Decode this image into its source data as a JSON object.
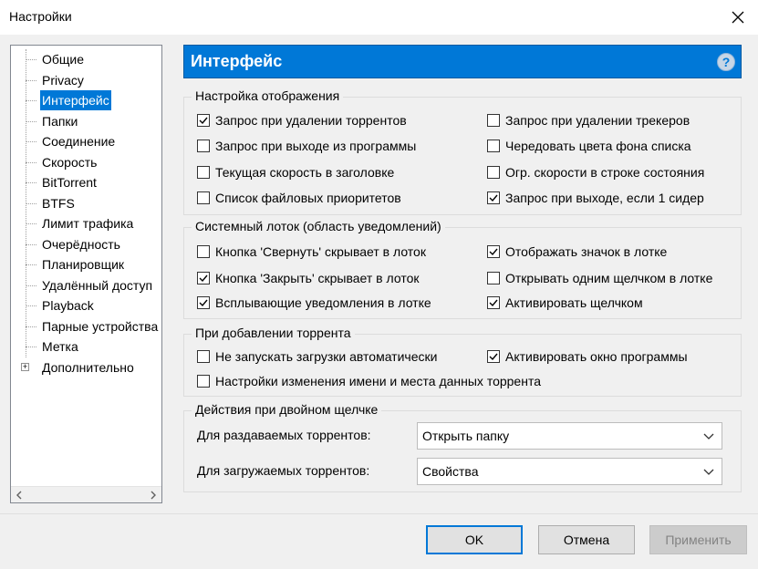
{
  "window": {
    "title": "Настройки"
  },
  "tree": {
    "items": [
      {
        "label": "Общие"
      },
      {
        "label": "Privacy"
      },
      {
        "label": "Интерфейс",
        "selected": true
      },
      {
        "label": "Папки"
      },
      {
        "label": "Соединение"
      },
      {
        "label": "Скорость"
      },
      {
        "label": "BitTorrent"
      },
      {
        "label": "BTFS"
      },
      {
        "label": "Лимит трафика"
      },
      {
        "label": "Очерёдность"
      },
      {
        "label": "Планировщик"
      },
      {
        "label": "Удалённый доступ"
      },
      {
        "label": "Playback"
      },
      {
        "label": "Парные устройства"
      },
      {
        "label": "Метка"
      },
      {
        "label": "Дополнительно",
        "expandable": true
      }
    ],
    "expander_symbol": "+"
  },
  "panel": {
    "title": "Интерфейс",
    "help_symbol": "?"
  },
  "display": {
    "legend": "Настройка отображения",
    "options": [
      {
        "label": "Запрос при удалении торрентов",
        "checked": true
      },
      {
        "label": "Запрос при удалении трекеров",
        "checked": false
      },
      {
        "label": "Запрос при выходе из программы",
        "checked": false
      },
      {
        "label": "Чередовать цвета фона списка",
        "checked": false
      },
      {
        "label": "Текущая скорость в заголовке",
        "checked": false
      },
      {
        "label": "Огр. скорости в строке состояния",
        "checked": false
      },
      {
        "label": "Список файловых приоритетов",
        "checked": false
      },
      {
        "label": "Запрос при выходе, если 1 сидер",
        "checked": true
      }
    ]
  },
  "tray": {
    "legend": "Системный лоток (область уведомлений)",
    "options": [
      {
        "label": "Кнопка 'Свернуть' скрывает в лоток",
        "checked": false
      },
      {
        "label": "Отображать значок в лотке",
        "checked": true
      },
      {
        "label": "Кнопка 'Закрыть' скрывает в лоток",
        "checked": true
      },
      {
        "label": "Открывать одним щелчком в лотке",
        "checked": false
      },
      {
        "label": "Всплывающие уведомления в лотке",
        "checked": true
      },
      {
        "label": "Активировать щелчком",
        "checked": true
      }
    ]
  },
  "adding": {
    "legend": "При добавлении торрента",
    "options": [
      {
        "label": "Не запускать загрузки автоматически",
        "checked": false
      },
      {
        "label": "Активировать окно программы",
        "checked": true
      },
      {
        "label": "Настройки изменения имени и места данных торрента",
        "checked": false
      }
    ]
  },
  "dblclick": {
    "legend": "Действия при двойном щелчке",
    "seeding_label": "Для раздаваемых торрентов:",
    "seeding_value": "Открыть папку",
    "downloading_label": "Для загружаемых торрентов:",
    "downloading_value": "Свойства"
  },
  "buttons": {
    "ok": "OK",
    "cancel": "Отмена",
    "apply": "Применить"
  },
  "colors": {
    "accent": "#0078d7",
    "header_text": "#ffffff",
    "disabled_text": "#838383"
  }
}
